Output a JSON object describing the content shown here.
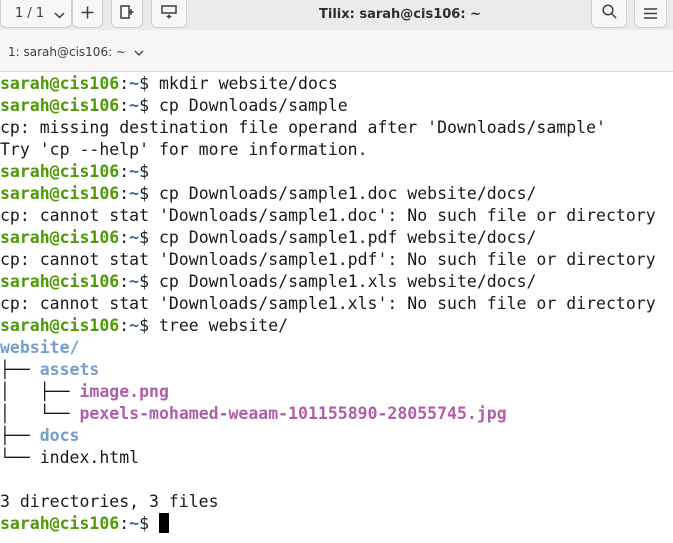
{
  "header": {
    "session_counter": "1 / 1",
    "title": "Tilix: sarah@cis106: ~",
    "icons": {
      "session_dropdown": "chevron-down-icon",
      "add_terminal": "plus-icon",
      "split_right": "split-right-icon",
      "split_down": "split-down-icon",
      "search": "search-icon",
      "menu": "hamburger-menu-icon"
    }
  },
  "tab": {
    "label": "1: sarah@cis106: ~"
  },
  "terminal": {
    "user_host": "sarah@cis106",
    "path": "~",
    "lines": [
      {
        "type": "prompt",
        "cmd": " mkdir website/docs"
      },
      {
        "type": "prompt",
        "cmd": " cp Downloads/sample"
      },
      {
        "type": "out",
        "text": "cp: missing destination file operand after 'Downloads/sample'"
      },
      {
        "type": "out",
        "text": "Try 'cp --help' for more information."
      },
      {
        "type": "prompt",
        "cmd": ""
      },
      {
        "type": "prompt",
        "cmd": " cp Downloads/sample1.doc website/docs/"
      },
      {
        "type": "out",
        "text": "cp: cannot stat 'Downloads/sample1.doc': No such file or directory"
      },
      {
        "type": "prompt",
        "cmd": " cp Downloads/sample1.pdf website/docs/"
      },
      {
        "type": "out",
        "text": "cp: cannot stat 'Downloads/sample1.pdf': No such file or directory"
      },
      {
        "type": "prompt",
        "cmd": " cp Downloads/sample1.xls website/docs/"
      },
      {
        "type": "out",
        "text": "cp: cannot stat 'Downloads/sample1.xls': No such file or directory"
      },
      {
        "type": "prompt",
        "cmd": " tree website/"
      },
      {
        "type": "tree",
        "prefix": "",
        "name": "website/",
        "kind": "dir"
      },
      {
        "type": "tree",
        "prefix": "├── ",
        "name": "assets",
        "kind": "dir"
      },
      {
        "type": "tree",
        "prefix": "│   ├── ",
        "name": "image.png",
        "kind": "img"
      },
      {
        "type": "tree",
        "prefix": "│   └── ",
        "name": "pexels-mohamed-weaam-101155890-28055745.jpg",
        "kind": "img"
      },
      {
        "type": "tree",
        "prefix": "├── ",
        "name": "docs",
        "kind": "dir"
      },
      {
        "type": "tree",
        "prefix": "└── ",
        "name": "index.html",
        "kind": "file"
      },
      {
        "type": "out",
        "text": ""
      },
      {
        "type": "out",
        "text": "3 directories, 3 files"
      },
      {
        "type": "prompt",
        "cmd": " ",
        "cursor": true
      }
    ]
  }
}
